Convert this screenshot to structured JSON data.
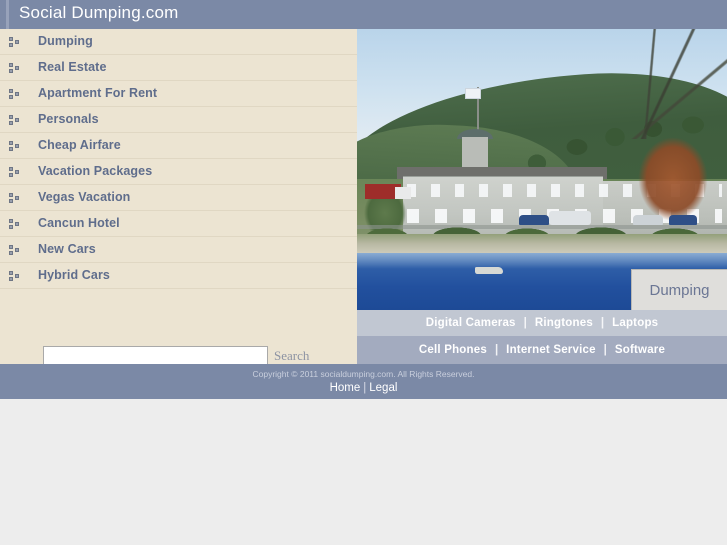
{
  "header": {
    "site_title": "Social Dumping.com",
    "bg_color": "#7b89a6"
  },
  "sidebar": {
    "bg_color": "#ece4d2",
    "items": [
      {
        "label": "Dumping"
      },
      {
        "label": "Real Estate"
      },
      {
        "label": "Apartment For Rent"
      },
      {
        "label": "Personals"
      },
      {
        "label": "Cheap Airfare"
      },
      {
        "label": "Vacation Packages"
      },
      {
        "label": "Vegas Vacation"
      },
      {
        "label": "Cancun Hotel"
      },
      {
        "label": "New Cars"
      },
      {
        "label": "Hybrid Cars"
      }
    ]
  },
  "search": {
    "value": "",
    "placeholder": "",
    "button_label": "Search"
  },
  "photo": {
    "caption": "Dumping",
    "alt": "Lakeside stone hotel with flag on forested hillside"
  },
  "ad_links": {
    "row1": [
      {
        "label": "Digital Cameras"
      },
      {
        "label": "Ringtones"
      },
      {
        "label": "Laptops"
      }
    ],
    "row2": [
      {
        "label": "Cell Phones"
      },
      {
        "label": "Internet Service"
      },
      {
        "label": "Software"
      }
    ],
    "separator": "|"
  },
  "footer": {
    "copyright": "Copyright © 2011 socialdumping.com. All Rights Reserved.",
    "links": [
      {
        "label": "Home"
      },
      {
        "label": "Legal"
      }
    ],
    "separator": "|"
  }
}
